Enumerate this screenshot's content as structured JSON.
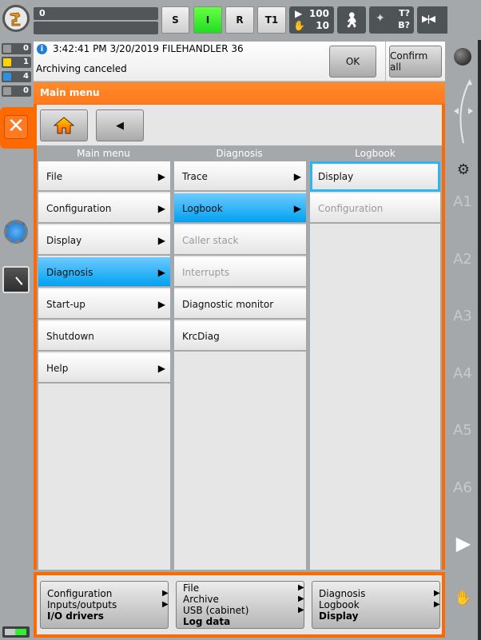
{
  "topbar": {
    "progress_value": "0",
    "progress_value2": "",
    "modes": [
      {
        "label": "S",
        "active": false
      },
      {
        "label": "I",
        "active": true
      },
      {
        "label": "R",
        "active": false
      },
      {
        "label": "T1",
        "active": false
      }
    ],
    "override": {
      "program": "100",
      "jog": "10"
    },
    "tool": {
      "t": "T?",
      "b": "B?"
    },
    "increment": "∞",
    "active_mode_color": "#33dd22"
  },
  "messages_counts": [
    {
      "type": "acknowledge",
      "count": "0"
    },
    {
      "type": "warning",
      "count": "1"
    },
    {
      "type": "info",
      "count": "4"
    },
    {
      "type": "dialog",
      "count": "0"
    }
  ],
  "message": {
    "time": "3:42:41 PM 3/20/2019 FILEHANDLER 36",
    "text": "Archiving canceled",
    "ok_label": "OK",
    "confirm_all_label": "Confirm all"
  },
  "main": {
    "title": "Main menu",
    "columns": [
      {
        "header": "Main menu",
        "items": [
          {
            "label": "File",
            "arrow": true,
            "state": "normal"
          },
          {
            "label": "Configuration",
            "arrow": true,
            "state": "normal"
          },
          {
            "label": "Display",
            "arrow": true,
            "state": "normal"
          },
          {
            "label": "Diagnosis",
            "arrow": true,
            "state": "selected"
          },
          {
            "label": "Start-up",
            "arrow": true,
            "state": "normal"
          },
          {
            "label": "Shutdown",
            "arrow": false,
            "state": "normal"
          },
          {
            "label": "Help",
            "arrow": true,
            "state": "normal"
          }
        ]
      },
      {
        "header": "Diagnosis",
        "items": [
          {
            "label": "Trace",
            "arrow": true,
            "state": "normal"
          },
          {
            "label": "Logbook",
            "arrow": true,
            "state": "selected"
          },
          {
            "label": "Caller stack",
            "arrow": false,
            "state": "disabled"
          },
          {
            "label": "Interrupts",
            "arrow": false,
            "state": "disabled"
          },
          {
            "label": "Diagnostic monitor",
            "arrow": false,
            "state": "normal"
          },
          {
            "label": "KrcDiag",
            "arrow": false,
            "state": "normal"
          }
        ]
      },
      {
        "header": "Logbook",
        "items": [
          {
            "label": "Display",
            "arrow": false,
            "state": "focused"
          },
          {
            "label": "Configuration",
            "arrow": false,
            "state": "disabled"
          }
        ]
      }
    ],
    "arrow_glyph": "▶",
    "back_glyph": "◀"
  },
  "history": [
    {
      "lines": [
        "Configuration",
        "Inputs/outputs"
      ],
      "last": "I/O drivers"
    },
    {
      "lines": [
        "File",
        "Archive",
        "USB (cabinet)"
      ],
      "last": "Log data"
    },
    {
      "lines": [
        "Diagnosis",
        "Logbook"
      ],
      "last": "Display"
    }
  ],
  "right_axes": [
    "A1",
    "A2",
    "A3",
    "A4",
    "A5",
    "A6"
  ],
  "colors": {
    "accent_orange": "#ff6a00",
    "selected_blue": "#00a2f0",
    "focus_blue": "#30b4f0"
  }
}
